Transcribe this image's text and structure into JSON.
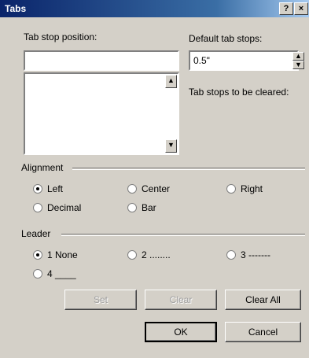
{
  "window": {
    "title": "Tabs",
    "help_label": "?",
    "close_label": "×"
  },
  "tab_stop_position": {
    "label": "Tab stop position:",
    "value": ""
  },
  "default_tab_stops": {
    "label": "Default tab stops:",
    "value": "0.5\""
  },
  "cleared_label": "Tab stops to be cleared:",
  "alignment": {
    "title": "Alignment",
    "options": [
      "Left",
      "Center",
      "Right",
      "Decimal",
      "Bar"
    ],
    "selected": "Left"
  },
  "leader": {
    "title": "Leader",
    "options": [
      "1 None",
      "2 ........",
      "3 -------",
      "4 ____"
    ],
    "selected": "1 None"
  },
  "buttons": {
    "set": "Set",
    "clear": "Clear",
    "clear_all": "Clear All",
    "ok": "OK",
    "cancel": "Cancel"
  }
}
